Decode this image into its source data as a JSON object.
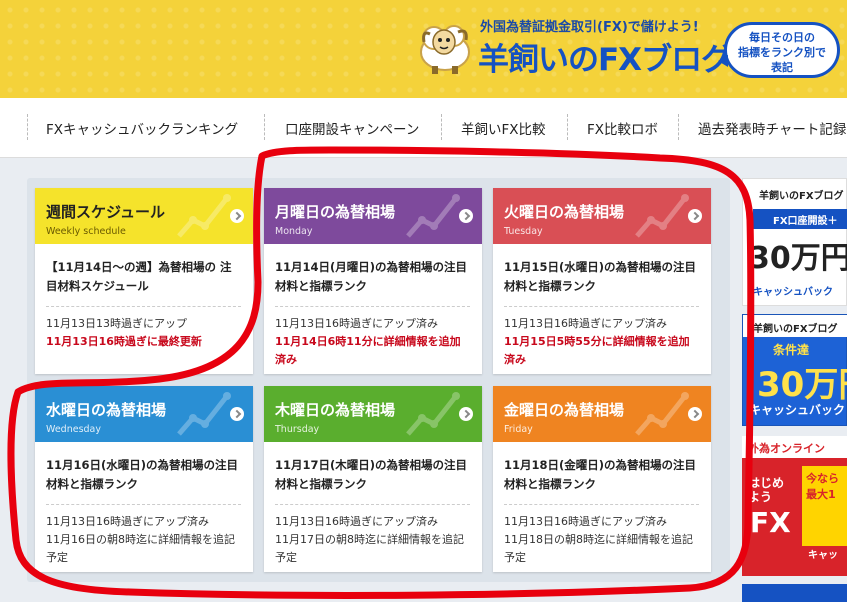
{
  "header": {
    "tagline": "外国為替証拠金取引(FX)で儲けよう!",
    "logo": "羊飼いのFXブログ",
    "bubble": [
      "毎日その日の",
      "指標をランク別で",
      "表記"
    ]
  },
  "nav": [
    {
      "label": "FXキャッシュバックランキング"
    },
    {
      "label": "口座開設キャンペーン"
    },
    {
      "label": "羊飼いFX比較"
    },
    {
      "label": "FX比較ロボ"
    },
    {
      "label": "過去発表時チャート記録"
    }
  ],
  "cards": [
    {
      "title": "週間スケジュール",
      "subtitle": "Weekly schedule",
      "desc": "【11月14日〜の週】為替相場の 注目材料スケジュール",
      "meta1": "11月13日13時過ぎにアップ",
      "meta2": "11月13日16時過ぎに最終更新",
      "color": "#f5e32b"
    },
    {
      "title": "月曜日の為替相場",
      "subtitle": "Monday",
      "desc": "11月14日(月曜日)の為替相場の注目材料と指標ランク",
      "meta1": "11月13日16時過ぎにアップ済み",
      "meta2": "11月14日6時11分に詳細情報を追加済み",
      "color": "#7e4a9c"
    },
    {
      "title": "火曜日の為替相場",
      "subtitle": "Tuesday",
      "desc": "11月15日(水曜日)の為替相場の注目材料と指標ランク",
      "meta1": "11月13日16時過ぎにアップ済み",
      "meta2": "11月15日5時55分に詳細情報を追加済み",
      "color": "#d94f55"
    },
    {
      "title": "水曜日の為替相場",
      "subtitle": "Wednesday",
      "desc": "11月16日(水曜日)の為替相場の注目材料と指標ランク",
      "meta1": "11月13日16時過ぎにアップ済み",
      "meta2": "11月16日の朝8時迄に詳細情報を追記予定",
      "color": "#2a8fd4"
    },
    {
      "title": "木曜日の為替相場",
      "subtitle": "Thursday",
      "desc": "11月17日(木曜日)の為替相場の注目材料と指標ランク",
      "meta1": "11月13日16時過ぎにアップ済み",
      "meta2": "11月17日の朝8時迄に詳細情報を追記予定",
      "color": "#5aae2e"
    },
    {
      "title": "金曜日の為替相場",
      "subtitle": "Friday",
      "desc": "11月18日(金曜日)の為替相場の注目材料と指標ランク",
      "meta1": "11月13日16時過ぎにアップ済み",
      "meta2": "11月18日の朝8時迄に詳細情報を追記予定",
      "color": "#ef8421"
    }
  ],
  "sidebar": {
    "top": {
      "t1": "羊飼いのFXブログ",
      "t2": "FX口座開設＋",
      "t3": "30万円+",
      "t4": "キャッシュバック"
    },
    "mid": {
      "m1": "羊飼いのFXブログ",
      "m2": "条件達",
      "m3": "30万円",
      "m4": "キャッシュバック"
    },
    "bot": {
      "b1": "外為オンライン",
      "b2": "はじめよう",
      "b3": "FX",
      "b4": "今なら 最大1",
      "b5": "キャッ"
    }
  },
  "colors": {
    "header_bg": "#f4d23a",
    "brand_blue": "#1552c2",
    "annotation_red": "#e8000e"
  }
}
